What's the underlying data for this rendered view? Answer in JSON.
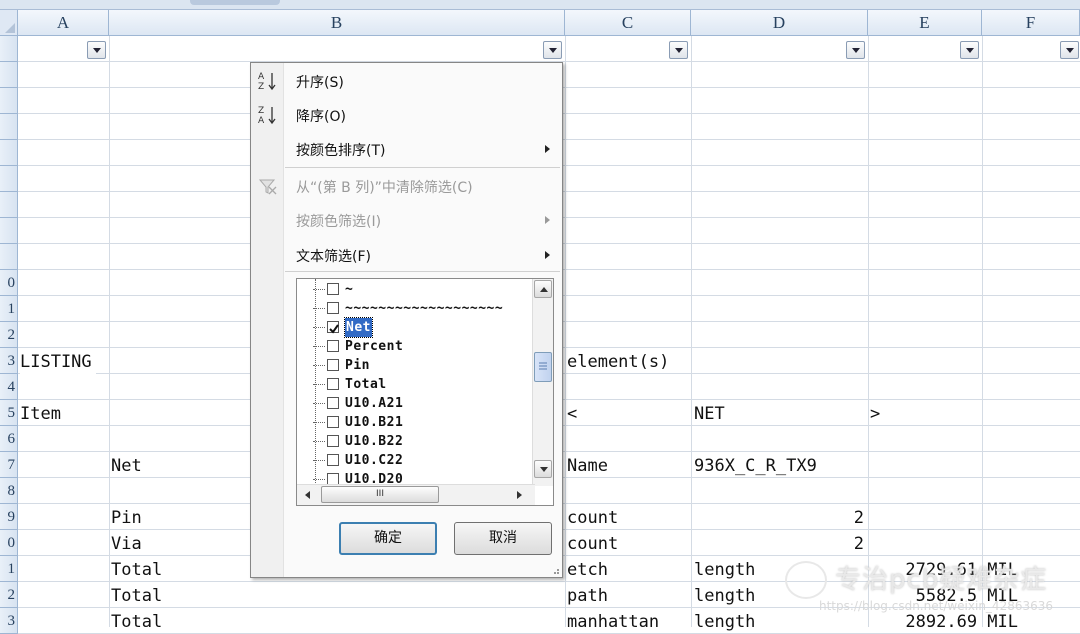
{
  "columns": [
    "A",
    "B",
    "C",
    "D",
    "E",
    "F"
  ],
  "row_numbers": [
    "",
    "",
    "",
    "",
    "",
    "",
    "",
    "",
    "",
    "0",
    "1",
    "2",
    "3",
    "4",
    "5",
    "6",
    "7",
    "8",
    "9",
    "0",
    "1",
    "2",
    "3"
  ],
  "cells": {
    "listing": "LISTING",
    "elements": "element(s)",
    "item": "Item",
    "lt": "<",
    "net_hdr": "NET",
    "gt": ">",
    "net_label": "Net",
    "name_label": "Name",
    "net_name": "936X_C_R_TX9",
    "pin_label": "Pin",
    "pin_count_label": "count",
    "pin_count": "2",
    "via_label": "Via",
    "via_count_label": "count",
    "via_count": "2",
    "total1": "Total",
    "etch": "etch",
    "length1": "length",
    "total1_val": "2729.61 MIL",
    "total2": "Total",
    "path": "path",
    "length2": "length",
    "total2_val": "5582.5 MIL",
    "total3": "Total",
    "manhattan": "manhattan",
    "length3": "length",
    "total3_val": "2892.69 MIL"
  },
  "menu": {
    "sort_asc": "升序(S)",
    "sort_desc": "降序(O)",
    "sort_by_color": "按颜色排序(T)",
    "clear_filter": "从“(第 B 列)”中清除筛选(C)",
    "filter_by_color": "按颜色筛选(I)",
    "text_filter": "文本筛选(F)",
    "icon_sort_asc": "sort-ascending-icon",
    "icon_sort_desc": "sort-descending-icon",
    "icon_clear": "clear-filter-icon"
  },
  "filter_list": [
    {
      "label": "~",
      "checked": false
    },
    {
      "label": "~~~~~~~~~~~~~~~~~~~",
      "checked": false
    },
    {
      "label": "Net",
      "checked": true,
      "selected": true
    },
    {
      "label": "Percent",
      "checked": false
    },
    {
      "label": "Pin",
      "checked": false
    },
    {
      "label": "Total",
      "checked": false
    },
    {
      "label": "U10.A21",
      "checked": false
    },
    {
      "label": "U10.B21",
      "checked": false
    },
    {
      "label": "U10.B22",
      "checked": false
    },
    {
      "label": "U10.C22",
      "checked": false
    },
    {
      "label": "U10.D20",
      "checked": false
    }
  ],
  "buttons": {
    "ok": "确定",
    "cancel": "取消"
  },
  "scroll_thumb_glyph": "III",
  "watermark": {
    "title": "专治pcb疑难杂症",
    "url": "https://blog.csdn.net/weixin_42863636"
  },
  "colors": {
    "header_bg": "#dde7f3",
    "grid": "#d4dbe4",
    "selection": "#316ac5",
    "default_button_border": "#3c7fb1"
  }
}
